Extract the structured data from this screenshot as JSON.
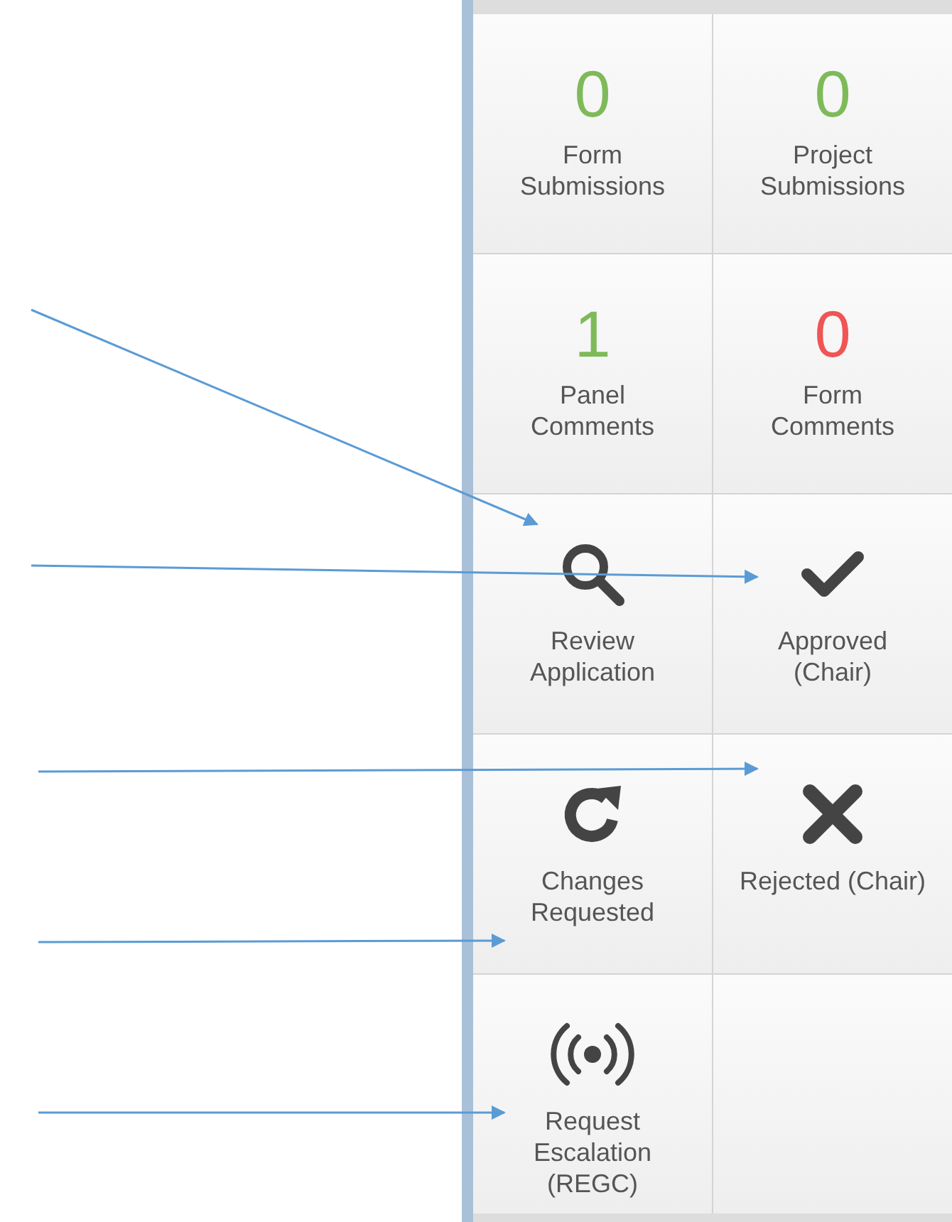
{
  "tiles": [
    {
      "kind": "count",
      "count": "0",
      "color": "#7fba5a",
      "label": "Form\nSubmissions"
    },
    {
      "kind": "count",
      "count": "0",
      "color": "#7fba5a",
      "label": "Project\nSubmissions"
    },
    {
      "kind": "count",
      "count": "1",
      "color": "#7fba5a",
      "label": "Panel\nComments"
    },
    {
      "kind": "count",
      "count": "0",
      "color": "#f05555",
      "label": "Form\nComments"
    },
    {
      "kind": "search",
      "label": "Review\nApplication"
    },
    {
      "kind": "check",
      "label": "Approved\n(Chair)"
    },
    {
      "kind": "refresh",
      "label": "Changes\nRequested"
    },
    {
      "kind": "cross",
      "label": "Rejected (Chair)"
    },
    {
      "kind": "broadcast",
      "label": "Request\nEscalation\n(REGC)"
    }
  ]
}
